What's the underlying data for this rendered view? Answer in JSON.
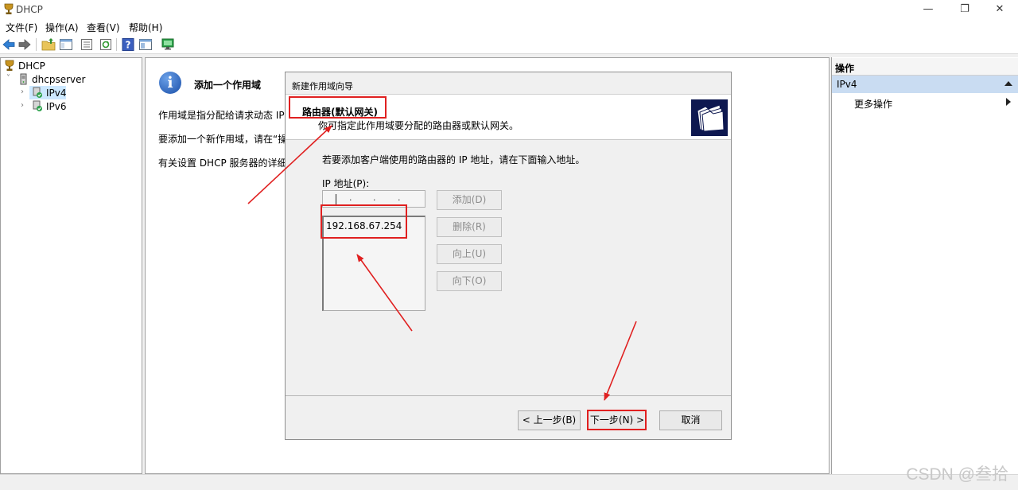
{
  "window": {
    "title": "DHCP",
    "minimize": "—",
    "restore": "❐",
    "close": "✕"
  },
  "menu": {
    "file": "文件(F)",
    "action": "操作(A)",
    "view": "查看(V)",
    "help": "帮助(H)"
  },
  "tree": {
    "root": "DHCP",
    "server": "dhcpserver",
    "ipv4": "IPv4",
    "ipv6": "IPv6",
    "expand": "›",
    "collapse": "˅"
  },
  "center": {
    "icon": "i",
    "heading": "添加一个作用域",
    "para1": "作用域是指分配给请求动态 IP 地",
    "para2": "要添加一个新作用域，请在“操作",
    "para3": "有关设置 DHCP 服务器的详细情"
  },
  "actions": {
    "header": "操作",
    "selected": "IPv4",
    "more": "更多操作"
  },
  "wizard": {
    "title": "新建作用域向导",
    "header_title": "路由器(默认网关)",
    "header_subtitle": "你可指定此作用域要分配的路由器或默认网关。",
    "instruction": "若要添加客户端使用的路由器的 IP 地址，请在下面输入地址。",
    "ip_label": "IP 地址(P):",
    "ip_dot": ".",
    "ip_list": [
      "192.168.67.254"
    ],
    "add": "添加(D)",
    "remove": "删除(R)",
    "up": "向上(U)",
    "down": "向下(O)",
    "back": "< 上一步(B)",
    "next": "下一步(N) >",
    "cancel": "取消"
  },
  "watermark": "CSDN @叁拾",
  "colors": {
    "annotation": "#e02020",
    "selection": "#c9dcf2",
    "wizard_icon_bg": "#0e1850"
  }
}
